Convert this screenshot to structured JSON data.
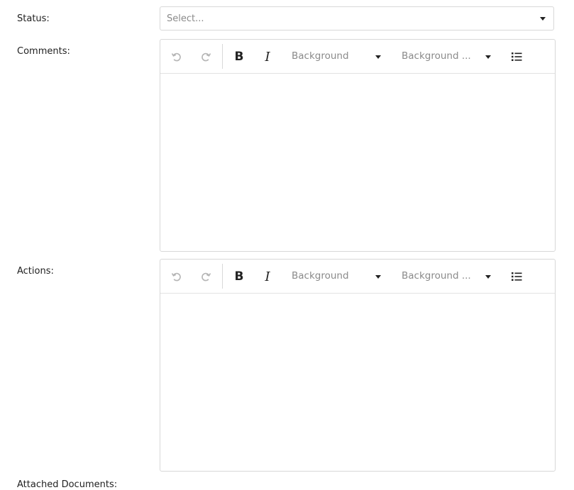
{
  "status": {
    "label": "Status:",
    "placeholder": "Select..."
  },
  "comments": {
    "label": "Comments:",
    "toolbar": {
      "undo_icon": "undo-icon",
      "redo_icon": "redo-icon",
      "bold_label": "B",
      "italic_label": "I",
      "dropdown1_label": "Background",
      "dropdown2_label": "Background ...",
      "list_icon": "bulleted-list-icon"
    },
    "content": ""
  },
  "actions": {
    "label": "Actions:",
    "toolbar": {
      "undo_icon": "undo-icon",
      "redo_icon": "redo-icon",
      "bold_label": "B",
      "italic_label": "I",
      "dropdown1_label": "Background",
      "dropdown2_label": "Background ...",
      "list_icon": "bulleted-list-icon"
    },
    "content": ""
  },
  "attached_documents": {
    "label": "Attached Documents:"
  }
}
